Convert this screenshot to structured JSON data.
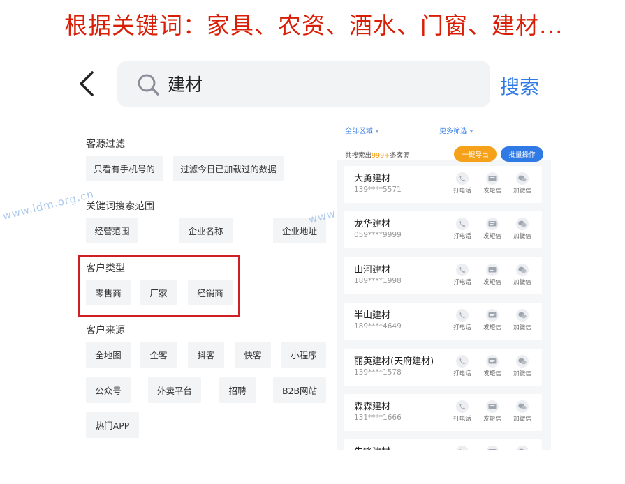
{
  "banner": "根据关键词：家具、农资、酒水、门窗、建材...",
  "search": {
    "value": "建材",
    "button": "搜索"
  },
  "filters": {
    "sections": [
      {
        "title": "客源过滤",
        "options": [
          "只看有手机号的",
          "过滤今日已加载过的数据"
        ]
      },
      {
        "title": "关键词搜索范围",
        "options": [
          "经营范围",
          "企业名称",
          "企业地址"
        ]
      },
      {
        "title": "客户类型",
        "options": [
          "零售商",
          "厂家",
          "经销商"
        ]
      },
      {
        "title": "客户来源",
        "options": [
          "全地图",
          "企客",
          "抖客",
          "快客",
          "小程序",
          "公众号",
          "外卖平台",
          "招聘",
          "B2B网站",
          "热门APP"
        ]
      }
    ]
  },
  "watermark": "www.ldm.org.cn",
  "results": {
    "region": "全部区域",
    "more_filter": "更多筛选",
    "count_prefix": "共搜索出",
    "count": "999+",
    "count_suffix": "条客源",
    "export": "一键导出",
    "batch": "批量操作",
    "actions": {
      "call": "打电话",
      "sms": "发短信",
      "wechat": "加微信"
    },
    "items": [
      {
        "name": "大勇建材",
        "phone": "139****5571"
      },
      {
        "name": "龙华建材",
        "phone": "059****9999"
      },
      {
        "name": "山河建材",
        "phone": "189****1998"
      },
      {
        "name": "半山建材",
        "phone": "189****4649"
      },
      {
        "name": "丽英建材(天府建材)",
        "phone": "139****1578"
      },
      {
        "name": "森森建材",
        "phone": "131****1666"
      },
      {
        "name": "朱锋建材",
        "phone": ""
      }
    ]
  },
  "colors": {
    "accent": "#2f7ae5",
    "banner": "#d81e06",
    "highlight": "#d01f24",
    "count": "#f6a11a"
  }
}
